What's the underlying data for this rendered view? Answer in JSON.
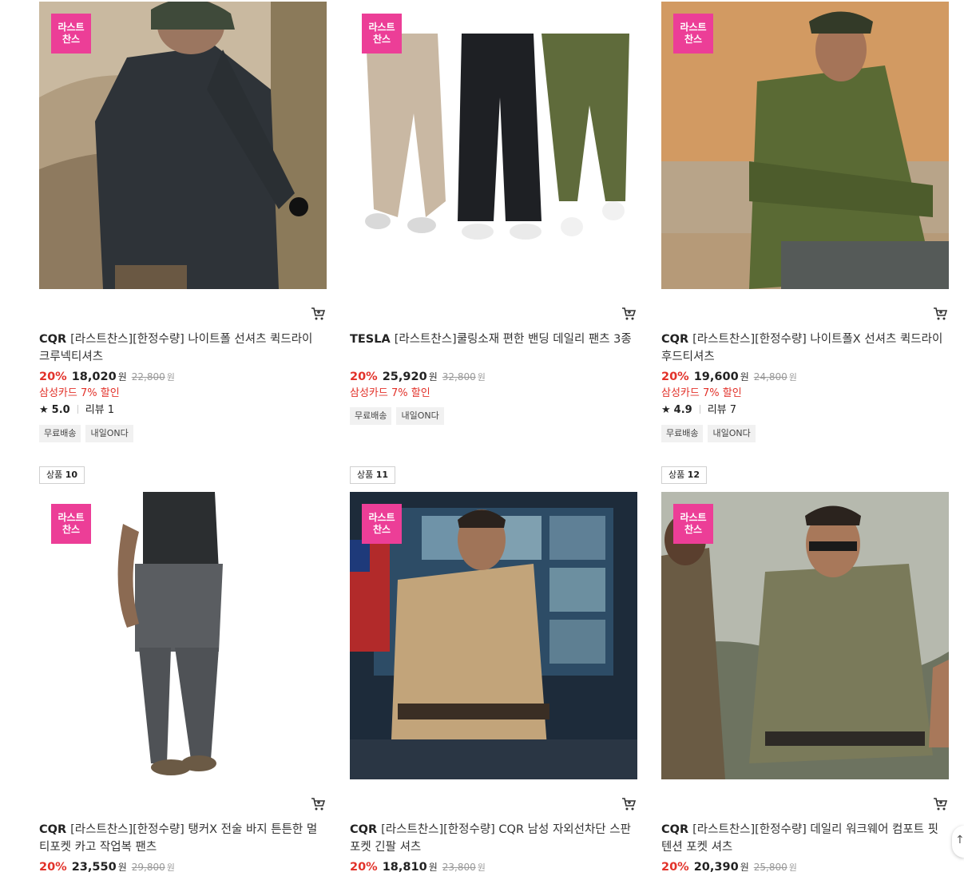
{
  "products": [
    {
      "rank_label": "",
      "rank_number": "",
      "badge_line1": "라스트",
      "badge_line2": "찬스",
      "brand": "CQR",
      "name": "[라스트찬스][한정수량] 나이트폴 선셔츠 퀵드라이 크루넥티셔츠",
      "discount": "20%",
      "price": "18,020",
      "price_unit": "원",
      "original_price": "22,800",
      "original_unit": "원",
      "card_discount": "삼성카드 7% 할인",
      "rating_star": "★",
      "rating": "5.0",
      "reviews": "리뷰 1",
      "tags": [
        "무료배송",
        "내일ON다"
      ],
      "image": "man-dark-long-sleeve-shirt-desert"
    },
    {
      "rank_label": "",
      "rank_number": "",
      "badge_line1": "라스트",
      "badge_line2": "찬스",
      "brand": "TESLA",
      "name": "[라스트찬스]쿨링소재 편한 밴딩 데일리 팬츠 3종",
      "discount": "20%",
      "price": "25,920",
      "price_unit": "원",
      "original_price": "32,800",
      "original_unit": "원",
      "card_discount": "삼성카드 7% 할인",
      "rating_star": "",
      "rating": "",
      "reviews": "",
      "tags": [
        "무료배송",
        "내일ON다"
      ],
      "image": "three-pants-beige-black-olive"
    },
    {
      "rank_label": "",
      "rank_number": "",
      "badge_line1": "라스트",
      "badge_line2": "찬스",
      "brand": "CQR",
      "name": "[라스트찬스][한정수량] 나이트폴X 선셔츠 퀵드라이 후드티셔츠",
      "discount": "20%",
      "price": "19,600",
      "price_unit": "원",
      "original_price": "24,800",
      "original_unit": "원",
      "card_discount": "삼성카드 7% 할인",
      "rating_star": "★",
      "rating": "4.9",
      "reviews": "리뷰 7",
      "tags": [
        "무료배송",
        "내일ON다"
      ],
      "image": "man-olive-hoodie-desert"
    },
    {
      "rank_label": "상품",
      "rank_number": "10",
      "badge_line1": "라스트",
      "badge_line2": "찬스",
      "brand": "CQR",
      "name": "[라스트찬스][한정수량] 탱커X 전술 바지 튼튼한 멀티포켓 카고 작업복 팬츠",
      "discount": "20%",
      "price": "23,550",
      "price_unit": "원",
      "original_price": "29,800",
      "original_unit": "원",
      "image": "man-grey-cargo-pants-backpack"
    },
    {
      "rank_label": "상품",
      "rank_number": "11",
      "badge_line1": "라스트",
      "badge_line2": "찬스",
      "brand": "CQR",
      "name": "[라스트찬스][한정수량] CQR 남성 자외선차단 스판 포켓 긴팔 셔츠",
      "discount": "20%",
      "price": "18,810",
      "price_unit": "원",
      "original_price": "23,800",
      "original_unit": "원",
      "image": "man-khaki-shirt-control-room"
    },
    {
      "rank_label": "상품",
      "rank_number": "12",
      "badge_line1": "라스트",
      "badge_line2": "찬스",
      "brand": "CQR",
      "name": "[라스트찬스][한정수량] 데일리 워크웨어 컴포트 핏 텐션 포켓 셔츠",
      "discount": "20%",
      "price": "20,390",
      "price_unit": "원",
      "original_price": "25,800",
      "original_unit": "원",
      "image": "man-olive-shirt-sunglasses"
    }
  ],
  "icons": {
    "cart": "cart-icon",
    "scroll_top": "arrow-up-icon"
  },
  "colors": {
    "badge": "#ec3e97",
    "discount": "#e2322a"
  }
}
